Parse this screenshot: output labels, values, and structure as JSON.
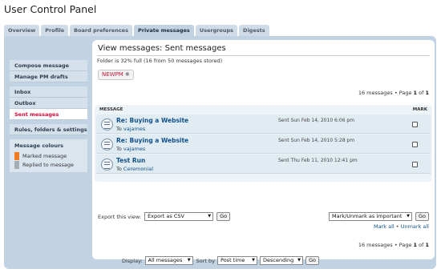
{
  "title": "User Control Panel",
  "tabs": [
    "Overview",
    "Profile",
    "Board preferences",
    "Private messages",
    "Usergroups",
    "Digests"
  ],
  "sidebar": {
    "groups": [
      [
        "Compose message",
        "Manage PM drafts"
      ],
      [
        "Inbox",
        "Outbox",
        "Sent messages"
      ],
      [
        "Rules, folders & settings"
      ]
    ],
    "colours_heading": "Message colours",
    "colours": [
      {
        "label": "Marked message",
        "color": "#f07b21"
      },
      {
        "label": "Replied to message",
        "color": "#a5adb4"
      }
    ]
  },
  "main": {
    "heading": "View messages: Sent messages",
    "folder_status": "Folder is 32% full (16 from 50 messages stored)",
    "newpm_label": "NEWPM",
    "page_info_prefix": "16 messages • Page ",
    "page_current": "1",
    "page_of": " of ",
    "page_total": "1",
    "col_message": "MESSAGE",
    "col_mark": "MARK",
    "messages": [
      {
        "subject": "Re: Buying a Website",
        "to_prefix": "To ",
        "to": "vajames",
        "sent": "Sent Sun Feb 14, 2010 6:06 pm"
      },
      {
        "subject": "Re: Buying a Website",
        "to_prefix": "To ",
        "to": "vajames",
        "sent": "Sent Sun Feb 14, 2010 5:28 pm"
      },
      {
        "subject": "Test Run",
        "to_prefix": "To ",
        "to": "Ceremonial",
        "sent": "Sent Thu Feb 11, 2010 12:41 pm"
      }
    ],
    "export_label": "Export this view:",
    "export_select": "Export as CSV",
    "go_label": "Go",
    "mark_select": "Mark/Unmark as important",
    "mark_all": "Mark all",
    "unmark_all": "Unmark all"
  },
  "footer": {
    "display_label": "Display:",
    "display_select": "All messages",
    "sort_label": "Sort by",
    "sort_select": "Post time",
    "order_select": "Descending",
    "go_label": "Go"
  }
}
